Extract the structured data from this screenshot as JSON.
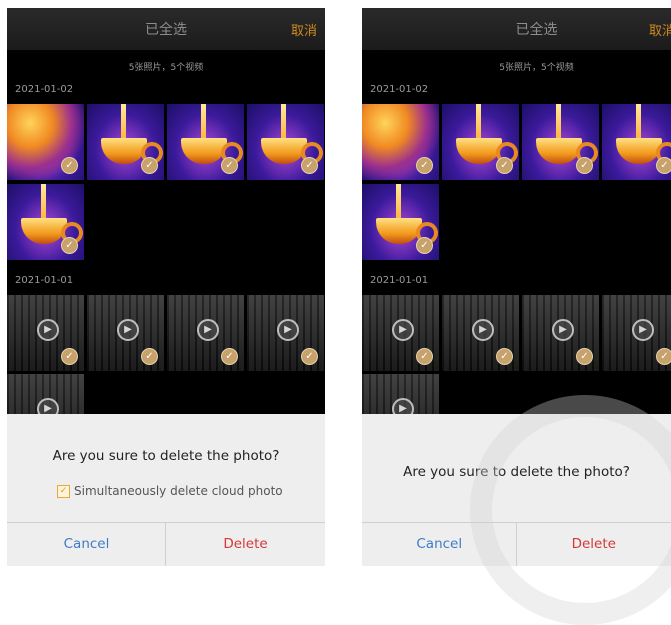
{
  "screens": [
    {
      "header": {
        "title": "已全选",
        "cancel": "取消"
      },
      "summary": "5张照片，5个视频",
      "groups": [
        {
          "date": "2021-01-02"
        },
        {
          "date": "2021-01-01"
        }
      ],
      "dialog": {
        "question": "Are you sure to delete the photo?",
        "cloud_option": "Simultaneously delete cloud photo",
        "cloud_checked": true,
        "cancel": "Cancel",
        "delete": "Delete"
      }
    },
    {
      "header": {
        "title": "已全选",
        "cancel": "取消"
      },
      "summary": "5张照片，5个视频",
      "groups": [
        {
          "date": "2021-01-02"
        },
        {
          "date": "2021-01-01"
        }
      ],
      "dialog": {
        "question": "Are you sure to delete the photo?",
        "cancel": "Cancel",
        "delete": "Delete"
      }
    }
  ],
  "icons": {
    "check": "checkmark-icon",
    "play": "play-icon",
    "checkbox": "checkbox-checked-icon"
  },
  "colors": {
    "accent": "#d08a1e",
    "cancel_text": "#3c7bc8",
    "delete_text": "#d63838",
    "check_badge": "#c7a26b"
  }
}
